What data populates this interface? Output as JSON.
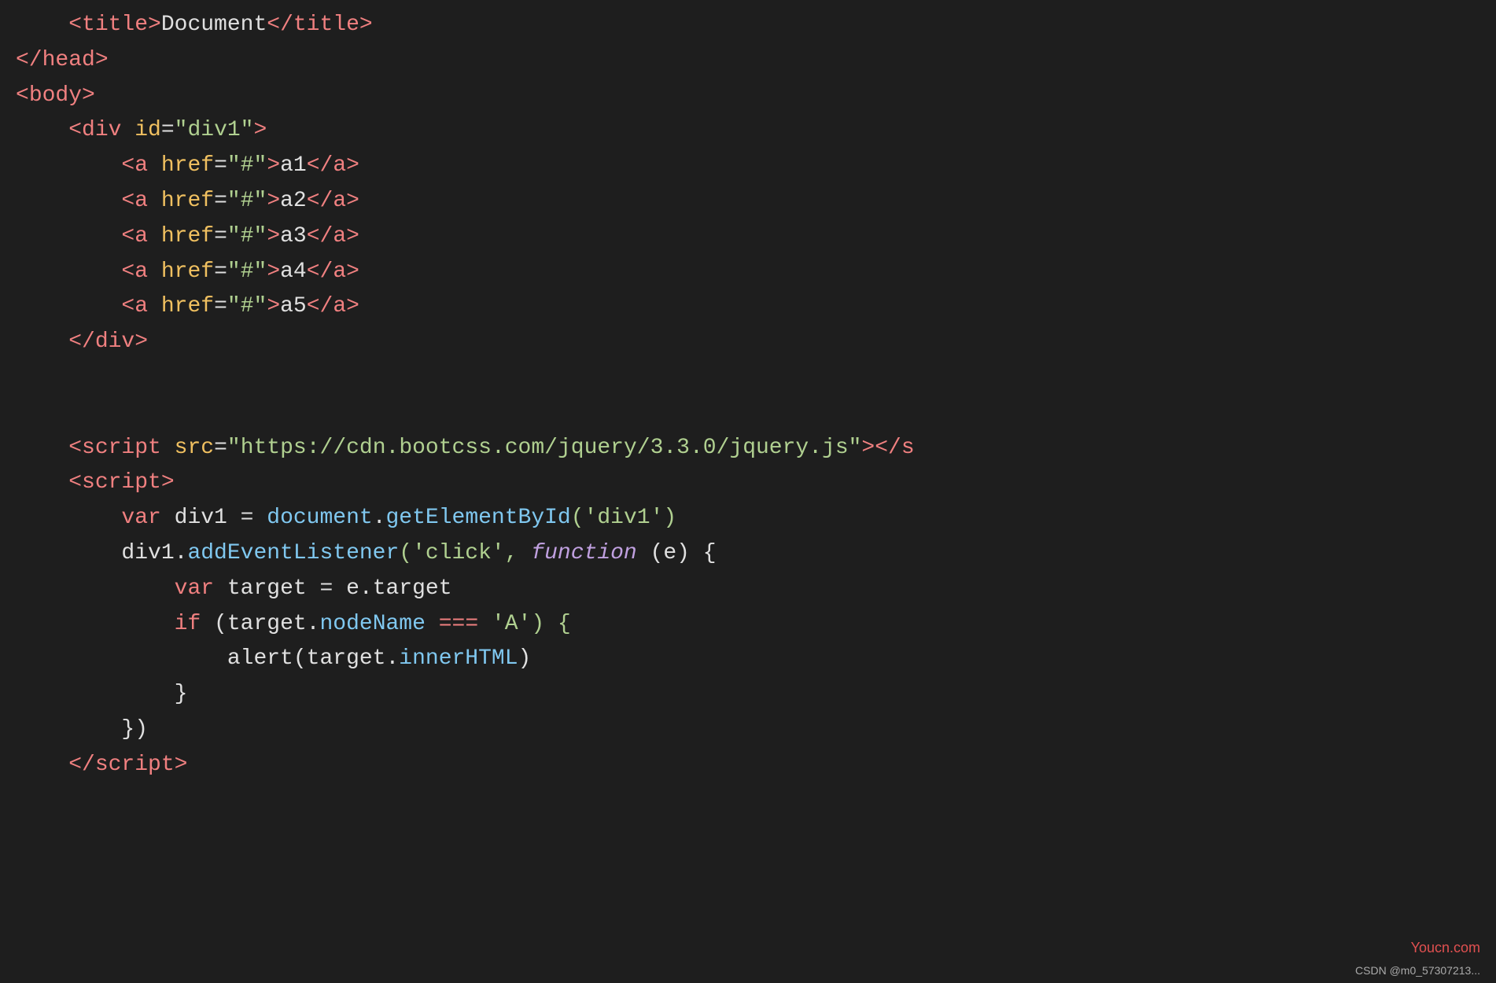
{
  "code": {
    "lines": [
      {
        "id": "line1",
        "parts": [
          {
            "text": "    <",
            "class": "tag"
          },
          {
            "text": "title",
            "class": "tag"
          },
          {
            "text": ">",
            "class": "tag"
          },
          {
            "text": "Document",
            "class": "punctuation"
          },
          {
            "text": "</",
            "class": "tag"
          },
          {
            "text": "title",
            "class": "tag"
          },
          {
            "text": ">",
            "class": "tag"
          }
        ]
      },
      {
        "id": "line2",
        "parts": [
          {
            "text": "</",
            "class": "tag"
          },
          {
            "text": "head",
            "class": "tag"
          },
          {
            "text": ">",
            "class": "tag"
          }
        ]
      },
      {
        "id": "line3",
        "parts": [
          {
            "text": "<",
            "class": "tag"
          },
          {
            "text": "body",
            "class": "tag"
          },
          {
            "text": ">",
            "class": "tag"
          }
        ]
      },
      {
        "id": "line4",
        "parts": [
          {
            "text": "    <",
            "class": "tag"
          },
          {
            "text": "div",
            "class": "tag"
          },
          {
            "text": " ",
            "class": "punctuation"
          },
          {
            "text": "id",
            "class": "attr-name"
          },
          {
            "text": "=",
            "class": "punctuation"
          },
          {
            "text": "\"div1\"",
            "class": "attr-value"
          },
          {
            "text": ">",
            "class": "tag"
          }
        ]
      },
      {
        "id": "line5",
        "parts": [
          {
            "text": "        <",
            "class": "tag"
          },
          {
            "text": "a",
            "class": "tag"
          },
          {
            "text": " ",
            "class": "punctuation"
          },
          {
            "text": "href",
            "class": "attr-name"
          },
          {
            "text": "=",
            "class": "punctuation"
          },
          {
            "text": "\"#\"",
            "class": "attr-value"
          },
          {
            "text": ">",
            "class": "tag"
          },
          {
            "text": "a1",
            "class": "punctuation"
          },
          {
            "text": "</",
            "class": "tag"
          },
          {
            "text": "a",
            "class": "tag"
          },
          {
            "text": ">",
            "class": "tag"
          }
        ]
      },
      {
        "id": "line6",
        "parts": [
          {
            "text": "        <",
            "class": "tag"
          },
          {
            "text": "a",
            "class": "tag"
          },
          {
            "text": " ",
            "class": "punctuation"
          },
          {
            "text": "href",
            "class": "attr-name"
          },
          {
            "text": "=",
            "class": "punctuation"
          },
          {
            "text": "\"#\"",
            "class": "attr-value"
          },
          {
            "text": ">",
            "class": "tag"
          },
          {
            "text": "a2",
            "class": "punctuation"
          },
          {
            "text": "</",
            "class": "tag"
          },
          {
            "text": "a",
            "class": "tag"
          },
          {
            "text": ">",
            "class": "tag"
          }
        ]
      },
      {
        "id": "line7",
        "parts": [
          {
            "text": "        <",
            "class": "tag"
          },
          {
            "text": "a",
            "class": "tag"
          },
          {
            "text": " ",
            "class": "punctuation"
          },
          {
            "text": "href",
            "class": "attr-name"
          },
          {
            "text": "=",
            "class": "punctuation"
          },
          {
            "text": "\"#\"",
            "class": "attr-value"
          },
          {
            "text": ">",
            "class": "tag"
          },
          {
            "text": "a3",
            "class": "punctuation"
          },
          {
            "text": "</",
            "class": "tag"
          },
          {
            "text": "a",
            "class": "tag"
          },
          {
            "text": ">",
            "class": "tag"
          }
        ]
      },
      {
        "id": "line8",
        "parts": [
          {
            "text": "        <",
            "class": "tag"
          },
          {
            "text": "a",
            "class": "tag"
          },
          {
            "text": " ",
            "class": "punctuation"
          },
          {
            "text": "href",
            "class": "attr-name"
          },
          {
            "text": "=",
            "class": "punctuation"
          },
          {
            "text": "\"#\"",
            "class": "attr-value"
          },
          {
            "text": ">",
            "class": "tag"
          },
          {
            "text": "a4",
            "class": "punctuation"
          },
          {
            "text": "</",
            "class": "tag"
          },
          {
            "text": "a",
            "class": "tag"
          },
          {
            "text": ">",
            "class": "tag"
          }
        ]
      },
      {
        "id": "line9",
        "parts": [
          {
            "text": "        <",
            "class": "tag"
          },
          {
            "text": "a",
            "class": "tag"
          },
          {
            "text": " ",
            "class": "punctuation"
          },
          {
            "text": "href",
            "class": "attr-name"
          },
          {
            "text": "=",
            "class": "punctuation"
          },
          {
            "text": "\"#\"",
            "class": "attr-value"
          },
          {
            "text": ">",
            "class": "tag"
          },
          {
            "text": "a5",
            "class": "punctuation"
          },
          {
            "text": "</",
            "class": "tag"
          },
          {
            "text": "a",
            "class": "tag"
          },
          {
            "text": ">",
            "class": "tag"
          }
        ]
      },
      {
        "id": "line10",
        "parts": [
          {
            "text": "    </",
            "class": "tag"
          },
          {
            "text": "div",
            "class": "tag"
          },
          {
            "text": ">",
            "class": "tag"
          }
        ]
      },
      {
        "id": "line11",
        "parts": []
      },
      {
        "id": "line12",
        "parts": []
      },
      {
        "id": "line13",
        "parts": [
          {
            "text": "    <",
            "class": "tag"
          },
          {
            "text": "script",
            "class": "tag"
          },
          {
            "text": " ",
            "class": "punctuation"
          },
          {
            "text": "src",
            "class": "attr-name"
          },
          {
            "text": "=",
            "class": "punctuation"
          },
          {
            "text": "\"https://cdn.bootcss.com/jquery/3.3.0/jquery.js\"",
            "class": "attr-value"
          },
          {
            "text": "></",
            "class": "tag"
          },
          {
            "text": "s",
            "class": "tag"
          }
        ]
      },
      {
        "id": "line14",
        "parts": [
          {
            "text": "    <",
            "class": "tag"
          },
          {
            "text": "script",
            "class": "tag"
          },
          {
            "text": ">",
            "class": "tag"
          }
        ]
      },
      {
        "id": "line15",
        "parts": [
          {
            "text": "        ",
            "class": "punctuation"
          },
          {
            "text": "var",
            "class": "keyword"
          },
          {
            "text": " div1 = ",
            "class": "variable"
          },
          {
            "text": "document",
            "class": "property"
          },
          {
            "text": ".",
            "class": "punctuation"
          },
          {
            "text": "getElementById",
            "class": "property"
          },
          {
            "text": "('div1')",
            "class": "string"
          }
        ]
      },
      {
        "id": "line16",
        "parts": [
          {
            "text": "        div1.",
            "class": "variable"
          },
          {
            "text": "addEventListener",
            "class": "property"
          },
          {
            "text": "('click', ",
            "class": "string"
          },
          {
            "text": "function",
            "class": "italic-keyword"
          },
          {
            "text": " (e) {",
            "class": "variable"
          }
        ]
      },
      {
        "id": "line17",
        "parts": [
          {
            "text": "            ",
            "class": "punctuation"
          },
          {
            "text": "var",
            "class": "keyword"
          },
          {
            "text": " target = e.target",
            "class": "variable"
          }
        ]
      },
      {
        "id": "line18",
        "parts": [
          {
            "text": "            ",
            "class": "punctuation"
          },
          {
            "text": "if",
            "class": "keyword"
          },
          {
            "text": " (target.",
            "class": "variable"
          },
          {
            "text": "nodeName",
            "class": "property"
          },
          {
            "text": " ",
            "class": "punctuation"
          },
          {
            "text": "===",
            "class": "operator"
          },
          {
            "text": " 'A') {",
            "class": "string"
          }
        ]
      },
      {
        "id": "line19",
        "parts": [
          {
            "text": "                alert(target.",
            "class": "variable"
          },
          {
            "text": "innerHTML",
            "class": "property"
          },
          {
            "text": ")",
            "class": "variable"
          }
        ]
      },
      {
        "id": "line20",
        "parts": [
          {
            "text": "            }",
            "class": "brace"
          }
        ]
      },
      {
        "id": "line21",
        "parts": [
          {
            "text": "        })",
            "class": "brace"
          }
        ]
      },
      {
        "id": "line22",
        "parts": [
          {
            "text": "    </",
            "class": "tag"
          },
          {
            "text": "script",
            "class": "tag"
          },
          {
            "text": ">",
            "class": "tag"
          }
        ]
      }
    ],
    "watermark1": "Youcn.com",
    "watermark2": "CSDN @m0_57307213..."
  }
}
